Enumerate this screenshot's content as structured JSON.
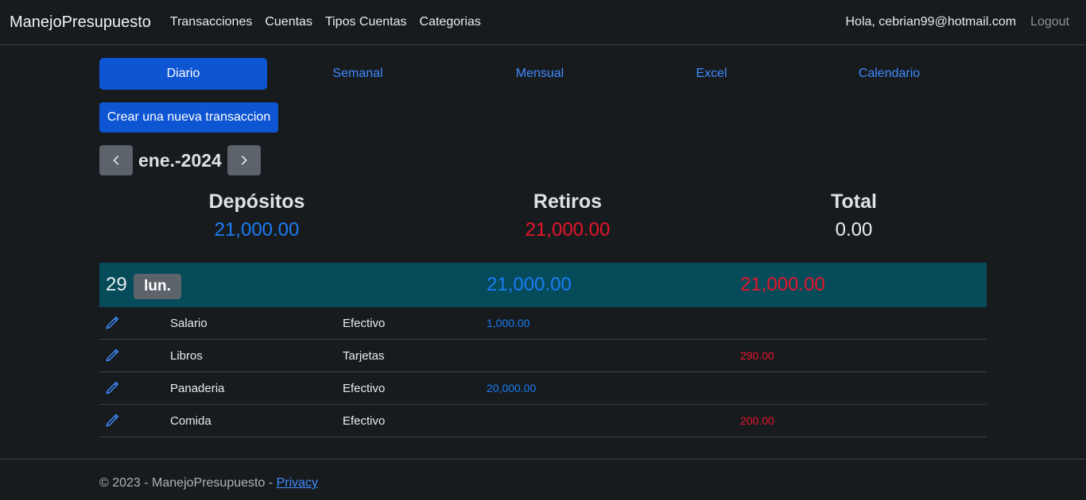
{
  "navbar": {
    "brand": "ManejoPresupuesto",
    "links": [
      "Transacciones",
      "Cuentas",
      "Tipos Cuentas",
      "Categorias"
    ],
    "greeting": "Hola, cebrian99@hotmail.com",
    "logout": "Logout"
  },
  "tabs": [
    {
      "label": "Diario",
      "active": true
    },
    {
      "label": "Semanal",
      "active": false
    },
    {
      "label": "Mensual",
      "active": false
    },
    {
      "label": "Excel",
      "active": false
    },
    {
      "label": "Calendario",
      "active": false
    }
  ],
  "create_button": "Crear una nueva transaccion",
  "month": {
    "label": "ene.-2024",
    "prev_icon": "chevron-left-icon",
    "next_icon": "chevron-right-icon"
  },
  "summary": {
    "deposits": {
      "title": "Depósitos",
      "value": "21,000.00"
    },
    "withdrawals": {
      "title": "Retiros",
      "value": "21,000.00"
    },
    "total": {
      "title": "Total",
      "value": "0.00"
    }
  },
  "days": [
    {
      "day": "29",
      "weekday": "lun.",
      "deposits": "21,000.00",
      "withdrawals": "21,000.00",
      "transactions": [
        {
          "category": "Salario",
          "account": "Efectivo",
          "deposit": "1,000.00",
          "withdrawal": ""
        },
        {
          "category": "Libros",
          "account": "Tarjetas",
          "deposit": "",
          "withdrawal": "290.00"
        },
        {
          "category": "Panaderia",
          "account": "Efectivo",
          "deposit": "20,000.00",
          "withdrawal": ""
        },
        {
          "category": "Comida",
          "account": "Efectivo",
          "deposit": "",
          "withdrawal": "200.00"
        }
      ]
    }
  ],
  "footer": {
    "text": "© 2023 - ManejoPresupuesto - ",
    "privacy_link": "Privacy"
  },
  "colors": {
    "background": "#181b1e",
    "primary": "#0d55d3",
    "link": "#3d8bfd",
    "deposit": "#1a7cf5",
    "withdrawal": "#e8142a",
    "day_header": "#054b5a",
    "secondary_button": "#5c636a"
  }
}
